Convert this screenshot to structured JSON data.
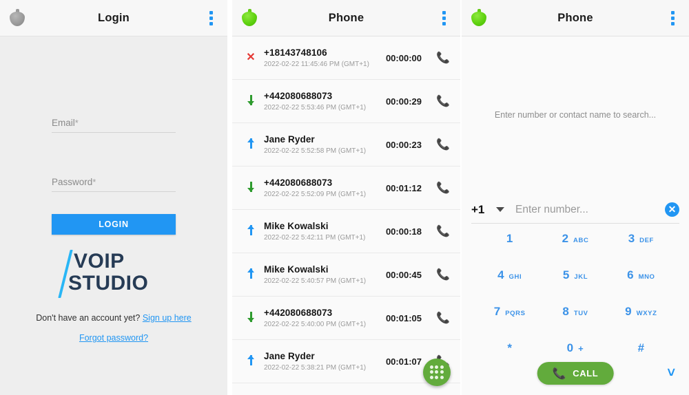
{
  "login": {
    "appbar": {
      "title": "Login",
      "icon": "voipstudio-logo-icon-grey",
      "menu_icon": "overflow-menu-icon"
    },
    "email": {
      "label": "Email",
      "required_marker": "*",
      "value": ""
    },
    "password": {
      "label": "Password",
      "required_marker": "*",
      "value": ""
    },
    "login_button": "LOGIN",
    "logo": {
      "line1": "VOIP",
      "line2": "STUDIO",
      "accent_color": "#29b6f6",
      "text_color": "#263b55"
    },
    "signup_prompt": "Don't have an account yet?",
    "signup_link": "Sign up here",
    "forgot_link": "Forgot password?",
    "accent_color": "#2196f3"
  },
  "calls": {
    "appbar": {
      "title": "Phone",
      "icon": "voipstudio-logo-icon-green",
      "menu_icon": "overflow-menu-icon"
    },
    "fab": {
      "icon": "dialpad-icon",
      "color": "#62ab3c"
    },
    "direction_colors": {
      "missed": "#e53935",
      "incoming": "#2e9b2e",
      "outgoing": "#2196f3"
    },
    "rows": [
      {
        "direction": "missed",
        "name": "+18143748106",
        "timestamp": "2022-02-22 11:45:46 PM (GMT+1)",
        "duration": "00:00:00"
      },
      {
        "direction": "incoming",
        "name": "+442080688073",
        "timestamp": "2022-02-22 5:53:46 PM (GMT+1)",
        "duration": "00:00:29"
      },
      {
        "direction": "outgoing",
        "name": "Jane Ryder",
        "timestamp": "2022-02-22 5:52:58 PM (GMT+1)",
        "duration": "00:00:23"
      },
      {
        "direction": "incoming",
        "name": "+442080688073",
        "timestamp": "2022-02-22 5:52:09 PM (GMT+1)",
        "duration": "00:01:12"
      },
      {
        "direction": "outgoing",
        "name": "Mike Kowalski",
        "timestamp": "2022-02-22 5:42:11 PM (GMT+1)",
        "duration": "00:00:18"
      },
      {
        "direction": "outgoing",
        "name": "Mike Kowalski",
        "timestamp": "2022-02-22 5:40:57 PM (GMT+1)",
        "duration": "00:00:45"
      },
      {
        "direction": "incoming",
        "name": "+442080688073",
        "timestamp": "2022-02-22 5:40:00 PM (GMT+1)",
        "duration": "00:01:05"
      },
      {
        "direction": "outgoing",
        "name": "Jane Ryder",
        "timestamp": "2022-02-22 5:38:21 PM (GMT+1)",
        "duration": "00:01:07"
      }
    ]
  },
  "dialer": {
    "appbar": {
      "title": "Phone",
      "icon": "voipstudio-logo-icon-green",
      "menu_icon": "overflow-menu-icon"
    },
    "search_hint": "Enter number or contact name to search...",
    "country_code": "+1",
    "number_placeholder": "Enter number...",
    "number_value": "",
    "clear_label": "✕",
    "keys": [
      {
        "digit": "1",
        "sub": ""
      },
      {
        "digit": "2",
        "sub": "ABC"
      },
      {
        "digit": "3",
        "sub": "DEF"
      },
      {
        "digit": "4",
        "sub": "GHI"
      },
      {
        "digit": "5",
        "sub": "JKL"
      },
      {
        "digit": "6",
        "sub": "MNO"
      },
      {
        "digit": "7",
        "sub": "PQRS"
      },
      {
        "digit": "8",
        "sub": "TUV"
      },
      {
        "digit": "9",
        "sub": "WXYZ"
      },
      {
        "digit": "*",
        "sub": ""
      },
      {
        "digit": "0",
        "sub": "+"
      },
      {
        "digit": "#",
        "sub": ""
      }
    ],
    "call_button": "CALL",
    "call_button_color": "#62ab3c",
    "collapse_icon": "chevron-down-icon",
    "key_color": "#3b92e8"
  }
}
